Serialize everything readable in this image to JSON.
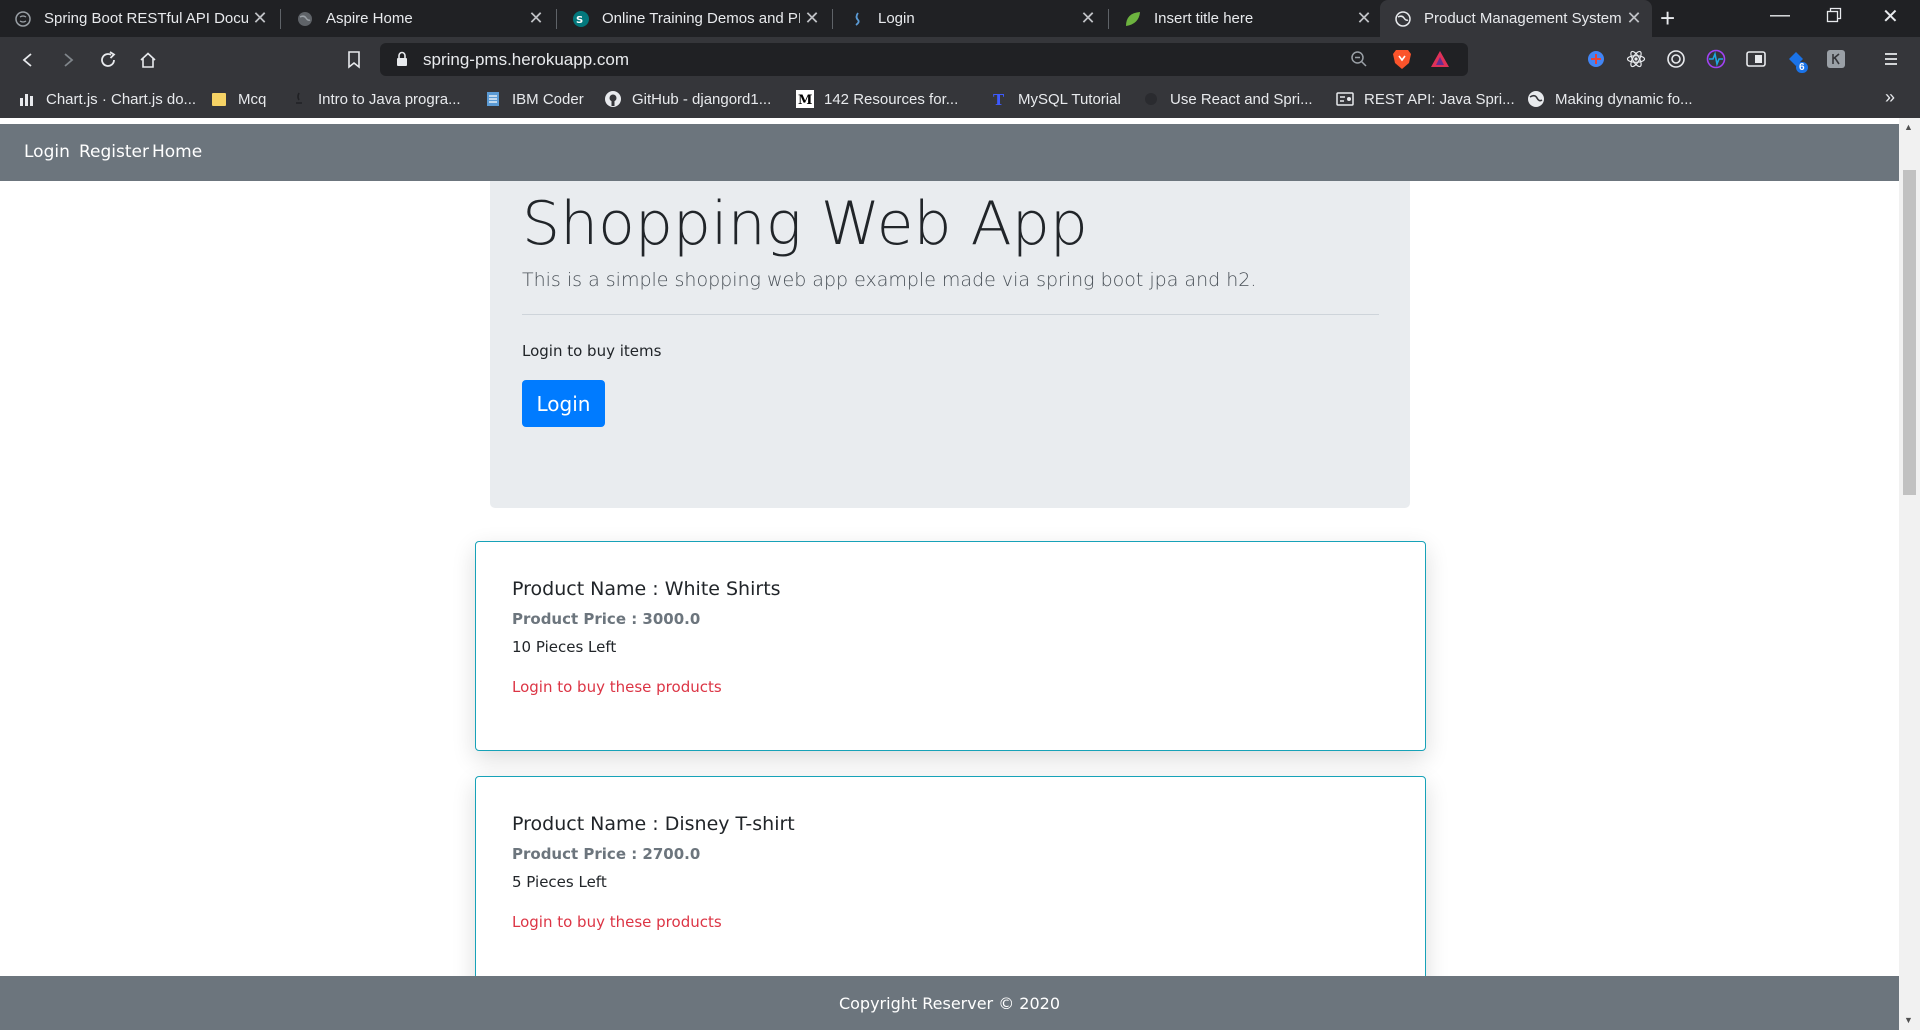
{
  "browser": {
    "tabs": [
      {
        "title": "Spring Boot RESTful API Docum",
        "icon": "swagger-icon"
      },
      {
        "title": "Aspire Home",
        "icon": "globe-icon"
      },
      {
        "title": "Online Training Demos and PP",
        "icon": "sharepoint-icon"
      },
      {
        "title": "Login",
        "icon": "java-icon"
      },
      {
        "title": "Insert title here",
        "icon": "spring-leaf-icon"
      },
      {
        "title": "Product Management System",
        "icon": "globe-icon"
      }
    ],
    "url": "spring-pms.herokuapp.com",
    "extension_badge": "6",
    "bookmarks": [
      {
        "label": "Chart.js · Chart.js do...",
        "icon": "chartjs-icon"
      },
      {
        "label": "Mcq",
        "icon": "folder-icon"
      },
      {
        "label": "Intro to Java progra...",
        "icon": "java-icon"
      },
      {
        "label": "IBM Coder",
        "icon": "ibm-icon"
      },
      {
        "label": "GitHub - djangord1...",
        "icon": "github-icon"
      },
      {
        "label": "142 Resources for...",
        "icon": "medium-icon"
      },
      {
        "label": "MySQL Tutorial",
        "icon": "tutorial-icon"
      },
      {
        "label": "Use React and Spri...",
        "icon": "react-icon"
      },
      {
        "label": "REST API: Java Spri...",
        "icon": "card-icon"
      },
      {
        "label": "Making dynamic fo...",
        "icon": "globe-icon"
      }
    ]
  },
  "page": {
    "nav": {
      "login": "Login",
      "register": "Register",
      "home": "Home"
    },
    "jumbotron": {
      "title": "Shopping Web App",
      "lead": "This is a simple shopping web app example made via spring boot jpa and h2.",
      "text": "Login to buy items",
      "button": "Login"
    },
    "products": [
      {
        "name": "Product Name : White Shirts",
        "price": "Product Price : 3000.0",
        "stock": "10 Pieces Left",
        "link": "Login to buy these products"
      },
      {
        "name": "Product Name : Disney T-shirt",
        "price": "Product Price : 2700.0",
        "stock": "5 Pieces Left",
        "link": "Login to buy these products"
      }
    ],
    "footer": "Copyright Reserver © 2020"
  },
  "colors": {
    "navbar": "#6c757d",
    "jumbotron": "#e9ecef",
    "primary_button": "#007bff",
    "card_border": "#17a2b8",
    "link": "#dc3545"
  }
}
